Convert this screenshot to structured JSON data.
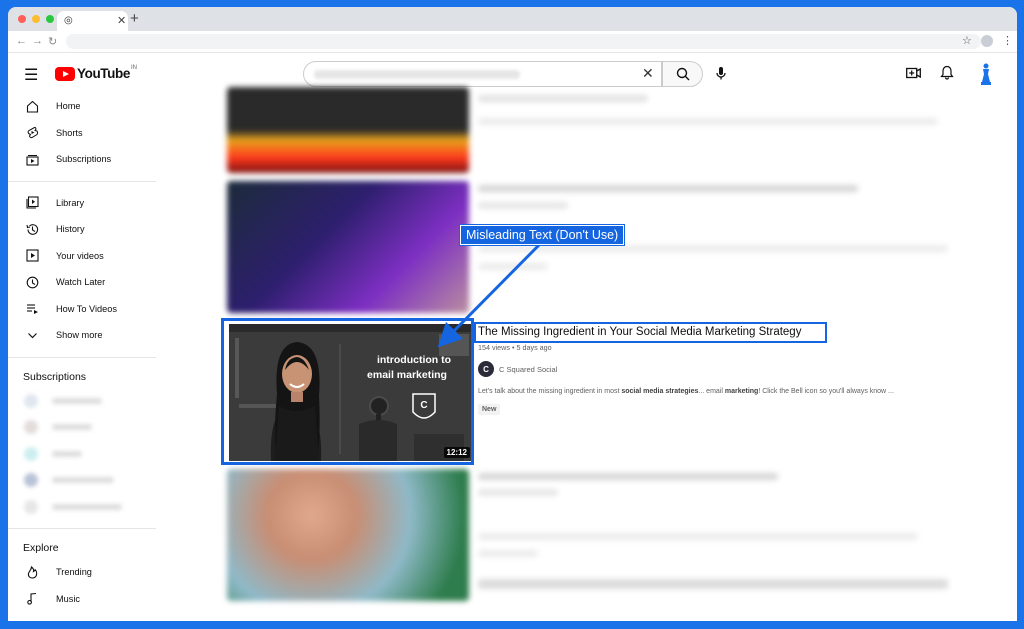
{
  "browser": {
    "tab_favicon": "chrome-icon",
    "new_tab_label": "+"
  },
  "youtube": {
    "logo_text": "YouTube",
    "country_code": "IN"
  },
  "sidebar": {
    "items": [
      {
        "label": "Home",
        "icon": "home-icon"
      },
      {
        "label": "Shorts",
        "icon": "shorts-icon"
      },
      {
        "label": "Subscriptions",
        "icon": "subscriptions-icon"
      },
      {
        "label": "Library",
        "icon": "library-icon"
      },
      {
        "label": "History",
        "icon": "history-icon"
      },
      {
        "label": "Your videos",
        "icon": "your-videos-icon"
      },
      {
        "label": "Watch Later",
        "icon": "watch-later-icon"
      },
      {
        "label": "How To Videos",
        "icon": "playlist-icon"
      },
      {
        "label": "Show more",
        "icon": "chevron-down-icon"
      }
    ],
    "subscriptions_heading": "Subscriptions",
    "explore_heading": "Explore",
    "explore_items": [
      {
        "label": "Trending",
        "icon": "trending-icon"
      },
      {
        "label": "Music",
        "icon": "music-icon"
      }
    ]
  },
  "video": {
    "title": "The Missing Ingredient in Your Social Media Marketing Strategy",
    "views": "154 views",
    "age": "5 days ago",
    "channel_initial": "C",
    "channel": "C Squared Social",
    "desc_part1": "Let's talk about the missing ingredient in most ",
    "desc_bold1": "social media strategies",
    "desc_part2": "... email ",
    "desc_bold2": "marketing",
    "desc_part3": "! Click the Bell icon so you'll always know ...",
    "badge": "New",
    "duration": "12:12",
    "thumb_line1": "introduction to",
    "thumb_line2": "email marketing",
    "thumb_badge": "C"
  },
  "annotation": {
    "label": "Misleading Text (Don't Use)",
    "color": "#1565e0"
  },
  "colors": {
    "frame": "#1a73e8",
    "brand": "#ff0000"
  }
}
